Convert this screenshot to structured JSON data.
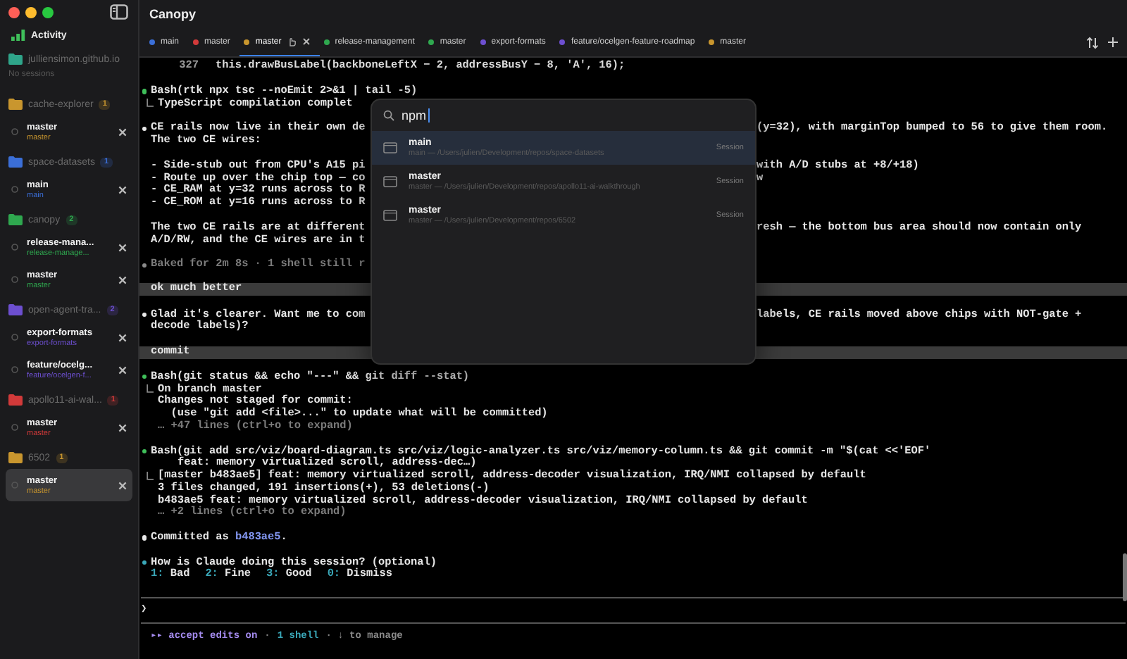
{
  "window": {
    "title": "Canopy"
  },
  "sidebar": {
    "activity": "Activity",
    "groups": [
      {
        "name": "julliensimon.github.io",
        "color": "#2fa58a",
        "empty_text": "No sessions"
      },
      {
        "name": "cache-explorer",
        "color": "#c9962e",
        "count": "1",
        "sessions": [
          {
            "title": "master",
            "branch": "master",
            "selected": false
          }
        ]
      },
      {
        "name": "space-datasets",
        "color": "#3b6fd8",
        "count": "1",
        "sessions": [
          {
            "title": "main",
            "branch": "main",
            "selected": false
          }
        ]
      },
      {
        "name": "canopy",
        "color": "#2fa84f",
        "count": "2",
        "sessions": [
          {
            "title": "release-mana...",
            "branch": "release-manage...",
            "selected": false
          },
          {
            "title": "master",
            "branch": "master",
            "selected": false
          }
        ]
      },
      {
        "name": "open-agent-tra...",
        "color": "#6d4fd0",
        "count": "2",
        "sessions": [
          {
            "title": "export-formats",
            "branch": "export-formats",
            "selected": false
          },
          {
            "title": "feature/ocelg...",
            "branch": "feature/ocelgen-f...",
            "selected": false
          }
        ]
      },
      {
        "name": "apollo11-ai-wal...",
        "color": "#d23a3a",
        "count": "1",
        "sessions": [
          {
            "title": "master",
            "branch": "master",
            "selected": false
          }
        ]
      },
      {
        "name": "6502",
        "color": "#c9962e",
        "count": "1",
        "sessions": [
          {
            "title": "master",
            "branch": "master",
            "selected": true
          }
        ]
      }
    ]
  },
  "tabs": [
    {
      "label": "main",
      "color": "#3b6fd8",
      "selected": false
    },
    {
      "label": "master",
      "color": "#d23a3a",
      "selected": false
    },
    {
      "label": "master",
      "color": "#c9962e",
      "selected": true
    },
    {
      "label": "release-management",
      "color": "#2fa84f",
      "selected": false
    },
    {
      "label": "master",
      "color": "#2fa84f",
      "selected": false
    },
    {
      "label": "export-formats",
      "color": "#6d4fd0",
      "selected": false
    },
    {
      "label": "feature/ocelgen-feature-roadmap",
      "color": "#6d4fd0",
      "selected": false
    },
    {
      "label": "master",
      "color": "#c9962e",
      "selected": false
    }
  ],
  "terminal": {
    "blocks": [
      {
        "kind": "code",
        "line_number": "327",
        "text": "this.drawBusLabel(backboneLeftX − 2, addressBusY − 8, 'A', 16);"
      },
      {
        "kind": "tool",
        "color": "#3fbf5a",
        "command": [
          "Bash(rtk npx tsc --noEmit 2>&1 | tail -5)"
        ],
        "output": [
          {
            "text": "TypeScript compilation complet"
          }
        ]
      },
      {
        "kind": "message",
        "color": "#e8e8e8",
        "paragraphs": [
          [
            {
              "text": "CE rails now live in their own de",
              "right": "(y=32), with marginTop bumped to 56 to give them room."
            },
            {
              "text": "The two CE wires:"
            }
          ],
          [
            {
              "text": "- Side-stub out from CPU's A15 pi",
              "right": "with A/D stubs at +8/+18)"
            },
            {
              "text": "- Route up over the chip top — co",
              "right": "w"
            },
            {
              "text": "- CE_RAM at y=32 runs across to R"
            },
            {
              "text": "- CE_ROM at y=16 runs across to R"
            }
          ],
          [
            {
              "text": "The two CE rails are at different",
              "right": "resh — the bottom bus area should now contain only"
            },
            {
              "text": "A/D/RW, and the CE wires are in t"
            }
          ]
        ]
      },
      {
        "kind": "status",
        "color": "#8a8a8a",
        "text": "Baked for 2m 8s · 1 shell still r"
      },
      {
        "kind": "prompt",
        "text": "ok much better"
      },
      {
        "kind": "message",
        "color": "#e8e8e8",
        "paragraphs": [
          [
            {
              "text": "Glad it's clearer. Want me to com",
              "right": "labels, CE rails moved above chips with NOT-gate +"
            },
            {
              "text": "decode labels)?"
            }
          ]
        ]
      },
      {
        "kind": "prompt",
        "text": "commit"
      },
      {
        "kind": "tool",
        "color": "#3fbf5a",
        "command": [
          "Bash(git status && echo \"---\" && git diff --stat)"
        ],
        "output": [
          {
            "text": "On branch master"
          },
          {
            "text": "Changes not staged for commit:"
          },
          {
            "text": "  (use \"git add <file>...\" to update what will be committed)"
          },
          {
            "text": "… +47 lines (ctrl+o to expand)",
            "muted": true
          }
        ]
      },
      {
        "kind": "tool",
        "color": "#3fbf5a",
        "command": [
          "Bash(git add src/viz/board-diagram.ts src/viz/logic-analyzer.ts src/viz/memory-column.ts && git commit -m \"$(cat <<'EOF'",
          "feat: memory virtualized scroll, address-dec…)"
        ],
        "output": [
          {
            "text": "[master b483ae5] feat: memory virtualized scroll, address-decoder visualization, IRQ/NMI collapsed by default"
          },
          {
            "text": "3 files changed, 191 insertions(+), 53 deletions(-)"
          },
          {
            "text": "b483ae5 feat: memory virtualized scroll, address-decoder visualization, IRQ/NMI collapsed by default"
          },
          {
            "text": "… +2 lines (ctrl+o to expand)",
            "muted": true
          }
        ]
      },
      {
        "kind": "message",
        "color": "#e8e8e8",
        "paragraphs": [
          [
            {
              "text": "Committed as",
              "hash": "b483ae5",
              "after": "."
            }
          ]
        ]
      },
      {
        "kind": "rating",
        "color": "#3aa7b8",
        "text": "How is Claude doing this session? (optional)",
        "options": [
          {
            "key": "1:",
            "label": "Bad"
          },
          {
            "key": "2:",
            "label": "Fine"
          },
          {
            "key": "3:",
            "label": "Good"
          },
          {
            "key": "0:",
            "label": "Dismiss"
          }
        ]
      }
    ],
    "prompt_symbol": "❯",
    "status": [
      {
        "text": "▸▸ accept edits on",
        "kind": "accent"
      },
      {
        "text": "·",
        "kind": "muted"
      },
      {
        "text": "1 shell",
        "kind": "info"
      },
      {
        "text": "· ↓ to manage",
        "kind": "muted"
      }
    ]
  },
  "palette": {
    "query": "npm",
    "results": [
      {
        "title": "main",
        "path": "main — /Users/julien/Development/repos/space-datasets",
        "type": "Session",
        "selected": true
      },
      {
        "title": "master",
        "path": "master — /Users/julien/Development/repos/apollo11-ai-walkthrough",
        "type": "Session",
        "selected": false
      },
      {
        "title": "master",
        "path": "master — /Users/julien/Development/repos/6502",
        "type": "Session",
        "selected": false
      }
    ]
  }
}
